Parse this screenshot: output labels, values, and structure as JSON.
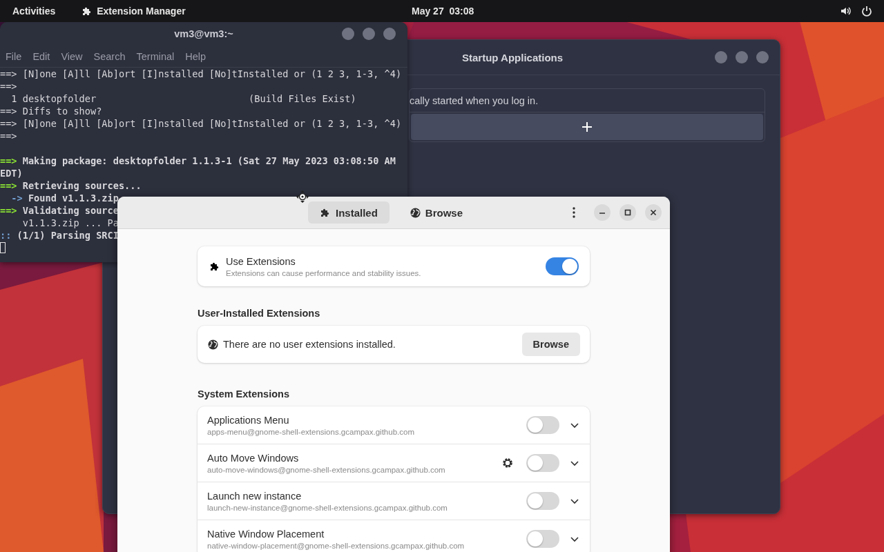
{
  "top_bar": {
    "activities": "Activities",
    "app_name": "Extension Manager",
    "clock": "May 27  03:08"
  },
  "terminal": {
    "title": "vm3@vm3:~",
    "menu": [
      "File",
      "Edit",
      "View",
      "Search",
      "Terminal",
      "Help"
    ],
    "lines": [
      {
        "kind": "text",
        "prefix": "==>",
        "text": " [N]one [A]ll [Ab]ort [I]nstalled [No]tInstalled or (1 2 3, 1-3, ^4)",
        "bold": false
      },
      {
        "kind": "text",
        "prefix": "==>",
        "bold": false
      },
      {
        "kind": "text",
        "text": "  1 desktopfolder                           (Build Files Exist)",
        "bold": false
      },
      {
        "kind": "text",
        "prefix": "==>",
        "text": " Diffs to show?",
        "bold": false
      },
      {
        "kind": "text",
        "prefix": "==>",
        "text": " [N]one [A]ll [Ab]ort [I]nstalled [No]tInstalled or (1 2 3, 1-3, ^4)",
        "bold": false
      },
      {
        "kind": "text",
        "prefix": "==>",
        "bold": false
      },
      {
        "kind": "blank"
      },
      {
        "kind": "text",
        "prefix": "==>",
        "color": "#8ae234",
        "text": " Making package: desktopfolder 1.1.3-1 (Sat 27 May 2023 03:08:50 AM",
        "bold": true
      },
      {
        "kind": "text",
        "text": "EDT)",
        "bold": true
      },
      {
        "kind": "text",
        "prefix": "==>",
        "color": "#8ae234",
        "text": " Retrieving sources...",
        "bold": true
      },
      {
        "kind": "text",
        "prefix": "  ->",
        "color": "#729fcf",
        "text": " Found v1.1.3.zip",
        "bold": true
      },
      {
        "kind": "text",
        "prefix": "==>",
        "color": "#8ae234",
        "text": " Validating source",
        "bold": true
      },
      {
        "kind": "text",
        "text": "    v1.1.3.zip ... Pa",
        "bold": false
      },
      {
        "kind": "text",
        "prefix": "::",
        "color": "#729fcf",
        "text": " (1/1) Parsing SRCI",
        "bold": true
      },
      {
        "kind": "cursor"
      }
    ]
  },
  "startup_window": {
    "title": "Startup Applications",
    "partial_text": "cally started when you log in."
  },
  "extension_manager": {
    "tabs": [
      {
        "label": "Installed",
        "selected": true
      },
      {
        "label": "Browse",
        "selected": false
      }
    ],
    "use_extensions": {
      "title": "Use Extensions",
      "subtitle": "Extensions can cause performance and stability issues.",
      "on": true
    },
    "user_section": {
      "heading": "User-Installed Extensions",
      "empty_text": "There are no user extensions installed.",
      "button": "Browse"
    },
    "system_section": {
      "heading": "System Extensions",
      "items": [
        {
          "name": "Applications Menu",
          "uuid": "apps-menu@gnome-shell-extensions.gcampax.github.com",
          "enabled": false,
          "has_settings": false,
          "expanded": false
        },
        {
          "name": "Auto Move Windows",
          "uuid": "auto-move-windows@gnome-shell-extensions.gcampax.github.com",
          "enabled": false,
          "has_settings": true,
          "expanded": false
        },
        {
          "name": "Launch new instance",
          "uuid": "launch-new-instance@gnome-shell-extensions.gcampax.github.com",
          "enabled": false,
          "has_settings": false,
          "expanded": false
        },
        {
          "name": "Native Window Placement",
          "uuid": "native-window-placement@gnome-shell-extensions.gcampax.github.com",
          "enabled": false,
          "has_settings": false,
          "expanded": false
        }
      ]
    }
  }
}
